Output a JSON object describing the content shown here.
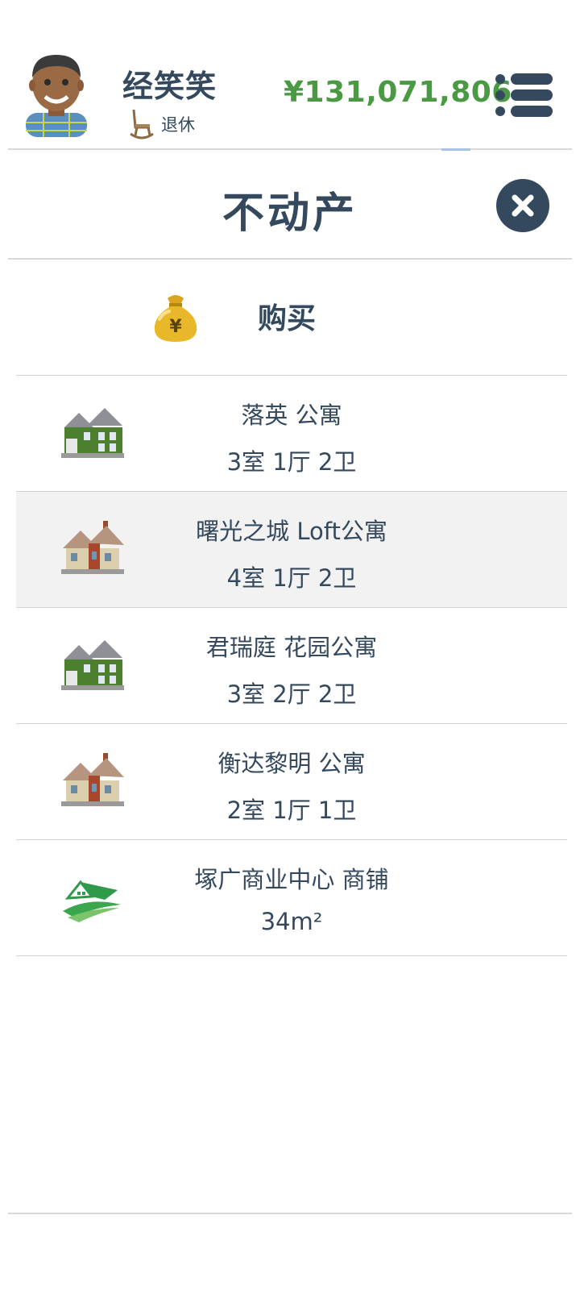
{
  "player": {
    "name": "经笑笑",
    "status_label": "退休",
    "money": "¥131,071,806"
  },
  "page": {
    "title": "不动产"
  },
  "buy": {
    "label": "购买"
  },
  "properties": [
    {
      "name": "落英 公寓",
      "detail": "3室 1厅 2卫",
      "icon": "green-house-icon"
    },
    {
      "name": "曙光之城 Loft公寓",
      "detail": "4室 1厅 2卫",
      "icon": "beige-house-icon"
    },
    {
      "name": "君瑞庭 花园公寓",
      "detail": "3室 2厅 2卫",
      "icon": "green-house-icon"
    },
    {
      "name": "衡达黎明 公寓",
      "detail": "2室 1厅 1卫",
      "icon": "beige-house-icon"
    },
    {
      "name": "塚广商业中心 商铺",
      "detail": "34m²",
      "icon": "shop-logo-icon"
    }
  ],
  "colors": {
    "text": "#34495e",
    "money": "#4a9a44",
    "close_button": "#34495e",
    "row_highlight": "#f2f2f2"
  }
}
